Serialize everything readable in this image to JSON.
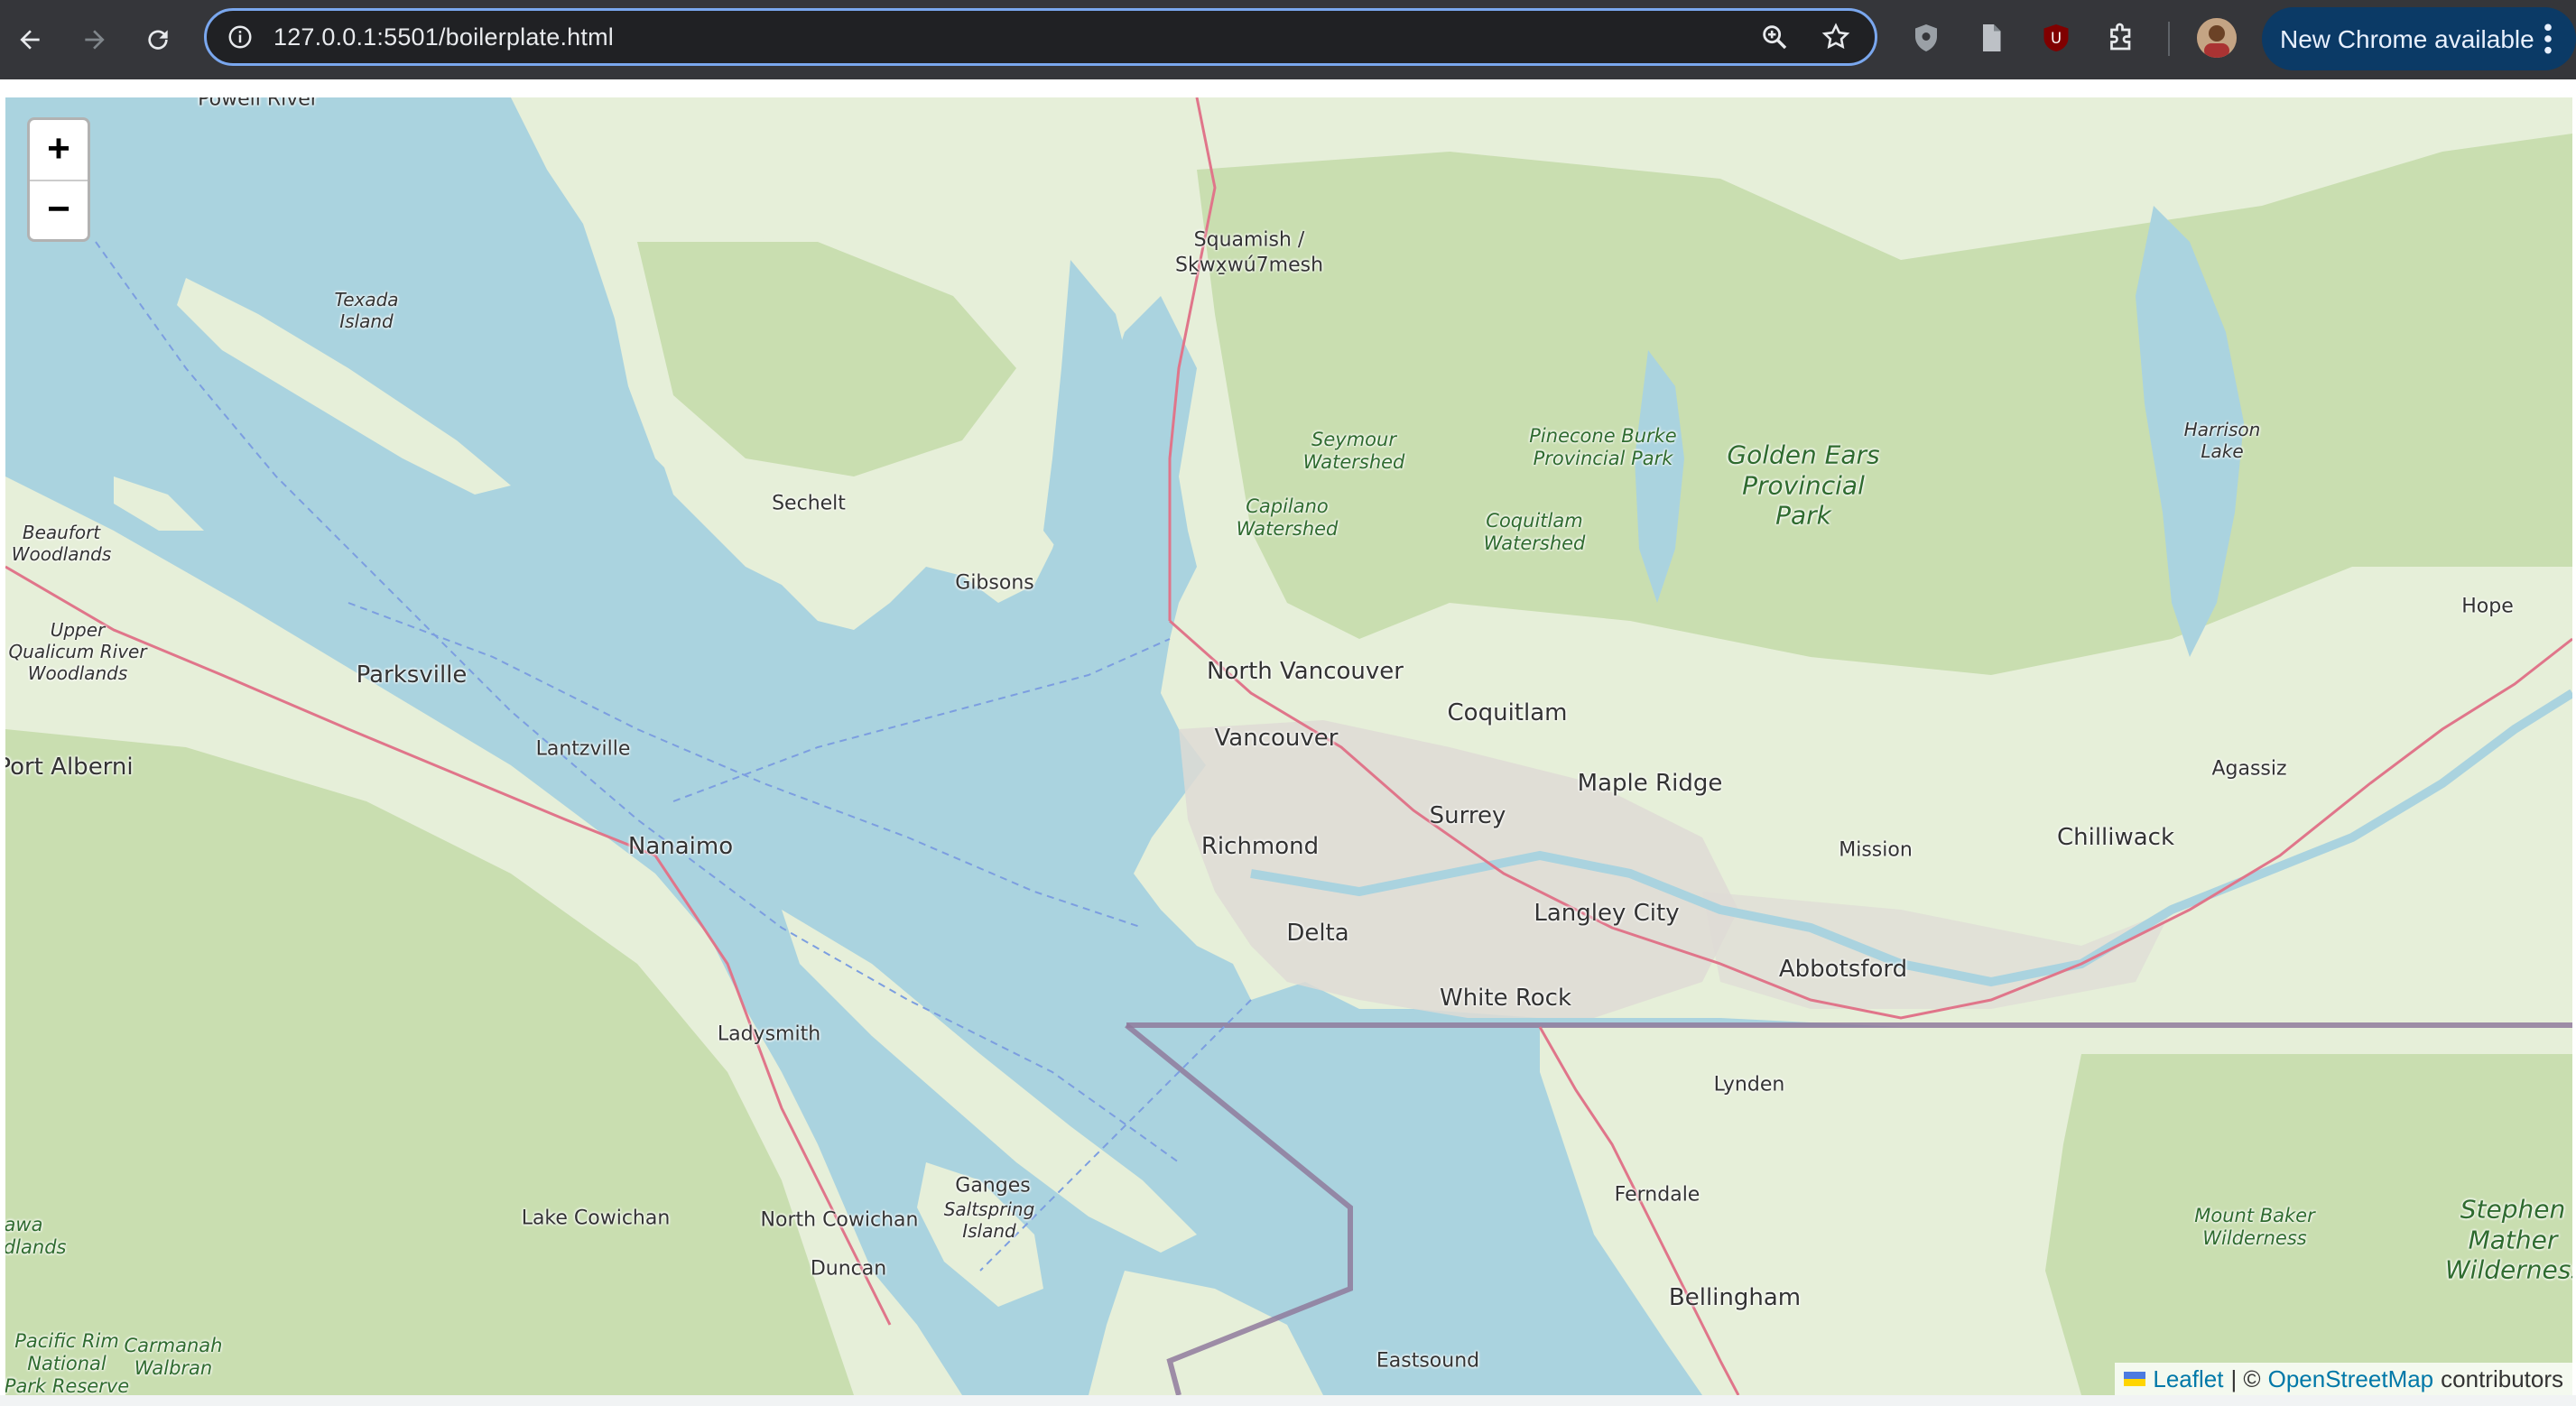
{
  "browser": {
    "url": "127.0.0.1:5501/boilerplate.html",
    "update_label": "New Chrome available"
  },
  "map": {
    "zoom_in_label": "+",
    "zoom_out_label": "−",
    "attribution": {
      "leaflet": "Leaflet",
      "separator": "| ©",
      "osm": "OpenStreetMap",
      "contributors": "contributors"
    },
    "places": {
      "powell_river": "Powell River",
      "texada_island": "Texada Island",
      "squamish": "Squamish / Sḵwx̱wú7mesh",
      "sechelt": "Sechelt",
      "gibsons": "Gibsons",
      "beaufort": "Beaufort Woodlands",
      "upper_qualicum": "Upper Qualicum River Woodlands",
      "parksville": "Parksville",
      "port_alberni": "Port Alberni",
      "lantzville": "Lantzville",
      "nanaimo": "Nanaimo",
      "ladysmith": "Ladysmith",
      "lake_cowichan": "Lake Cowichan",
      "north_cowichan": "North Cowichan",
      "duncan": "Duncan",
      "ganges": "Ganges",
      "saltspring": "Saltspring Island",
      "north_vancouver": "North Vancouver",
      "vancouver": "Vancouver",
      "richmond": "Richmond",
      "delta": "Delta",
      "coquitlam": "Coquitlam",
      "surrey": "Surrey",
      "maple_ridge": "Maple Ridge",
      "langley_city": "Langley City",
      "white_rock": "White Rock",
      "abbotsford": "Abbotsford",
      "mission": "Mission",
      "chilliwack": "Chilliwack",
      "agassiz": "Agassiz",
      "hope": "Hope",
      "lynden": "Lynden",
      "ferndale": "Ferndale",
      "bellingham": "Bellingham",
      "eastsound": "Eastsound",
      "seymour": "Seymour Watershed",
      "capilano": "Capilano Watershed",
      "coquitlam_ws": "Coquitlam Watershed",
      "pinecone": "Pinecone Burke Provincial Park",
      "golden_ears": "Golden Ears Provincial Park",
      "harrison_lake": "Harrison Lake",
      "mount_baker": "Mount Baker Wilderness",
      "stephen_mather": "Stephen Mather Wilderness",
      "pacific_rim": "Pacific Rim National Park Reserve",
      "carmanah": "Carmanah Walbran",
      "nitinat": "awa odlands"
    }
  },
  "colors": {
    "water": "#aad3df",
    "land": "#e6efd9",
    "forest": "#c9deb0",
    "urban": "#dedbd5",
    "border": "#8f7a9c",
    "road": "#e0758a"
  }
}
